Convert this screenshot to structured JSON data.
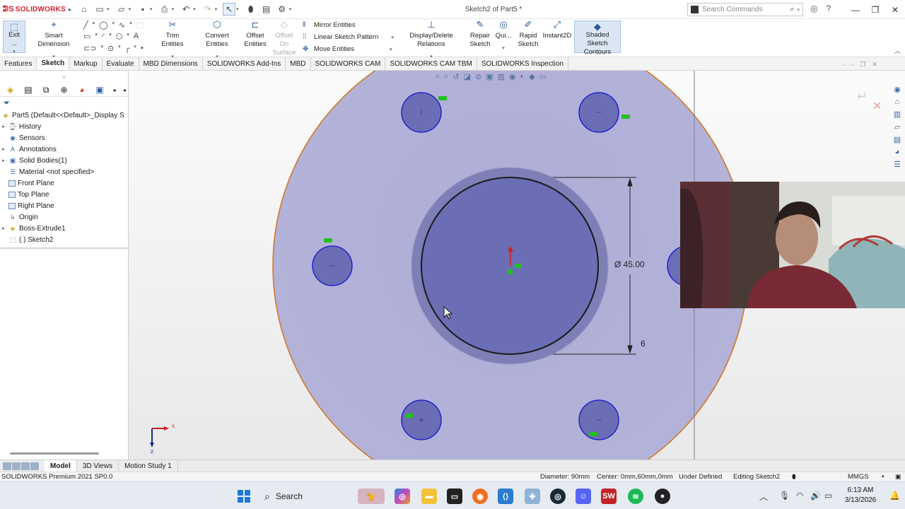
{
  "app": {
    "logo_text": "SOLIDWORKS",
    "window_title": "Sketch2 of Part5 *",
    "search_placeholder": "Search Commands"
  },
  "ribbon": {
    "exit_sketch": "Exit ...",
    "smart_dimension": "Smart Dimension",
    "trim_entities": "Trim Entities",
    "convert_entities": "Convert Entities",
    "offset_entities_1": "Offset",
    "offset_entities_2": "Entities",
    "offset_on_surface_1": "Offset On",
    "offset_on_surface_2": "Surface",
    "mirror_entities": "Mirror Entities",
    "linear_sketch_pattern": "Linear Sketch Pattern",
    "move_entities": "Move Entities",
    "display_delete_relations": "Display/Delete Relations",
    "repair_sketch_1": "Repair",
    "repair_sketch_2": "Sketch",
    "quick_snaps": "Qui...",
    "rapid_sketch_1": "Rapid",
    "rapid_sketch_2": "Sketch",
    "instant2d": "Instant2D",
    "shaded_contours_1": "Shaded Sketch",
    "shaded_contours_2": "Contours"
  },
  "tabs": [
    {
      "label": "Features"
    },
    {
      "label": "Sketch"
    },
    {
      "label": "Markup"
    },
    {
      "label": "Evaluate"
    },
    {
      "label": "MBD Dimensions"
    },
    {
      "label": "SOLIDWORKS Add-Ins"
    },
    {
      "label": "MBD"
    },
    {
      "label": "SOLIDWORKS CAM"
    },
    {
      "label": "SOLIDWORKS CAM TBM"
    },
    {
      "label": "SOLIDWORKS Inspection"
    }
  ],
  "tree": {
    "root": "Part5  (Default<<Default>_Display S",
    "items": [
      {
        "label": "History"
      },
      {
        "label": "Sensors"
      },
      {
        "label": "Annotations"
      },
      {
        "label": "Solid Bodies(1)"
      },
      {
        "label": "Material <not specified>"
      },
      {
        "label": "Front Plane"
      },
      {
        "label": "Top Plane"
      },
      {
        "label": "Right Plane"
      },
      {
        "label": "Origin"
      },
      {
        "label": "Boss-Extrude1"
      },
      {
        "label": "( ) Sketch2"
      }
    ]
  },
  "canvas": {
    "dim_diameter": "Ø 45.00",
    "dim_offset": "6",
    "axis_x": "x",
    "axis_y": "z"
  },
  "bottom_tabs": [
    {
      "label": "Model"
    },
    {
      "label": "3D Views"
    },
    {
      "label": "Motion Study 1"
    }
  ],
  "status": {
    "product": "SOLIDWORKS Premium 2021 SP0.0",
    "diameter": "Diameter: 90mm",
    "center": "Center: 0mm,60mm,0mm",
    "state": "Under Defined",
    "editing": "Editing Sketch2",
    "units": "MMGS"
  },
  "taskbar": {
    "search_label": "Search",
    "time": "6:13 AM",
    "date": "3/13/2026"
  },
  "colors": {
    "part_face": "#b2b0d6",
    "hole_fill": "#6b6db5",
    "edge": "#d07a2a",
    "sketch_blue": "#1414d0"
  }
}
